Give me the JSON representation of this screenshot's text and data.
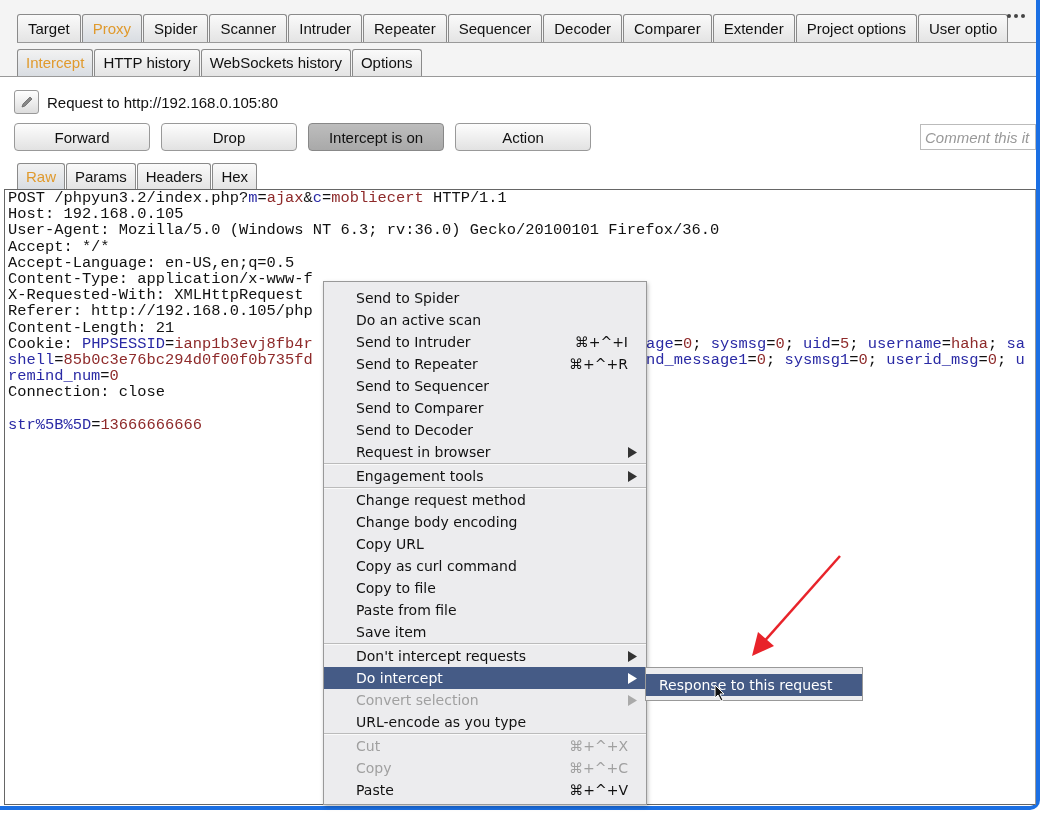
{
  "main_tabs": [
    {
      "label": "Target",
      "selected": false
    },
    {
      "label": "Proxy",
      "selected": true
    },
    {
      "label": "Spider",
      "selected": false
    },
    {
      "label": "Scanner",
      "selected": false
    },
    {
      "label": "Intruder",
      "selected": false
    },
    {
      "label": "Repeater",
      "selected": false
    },
    {
      "label": "Sequencer",
      "selected": false
    },
    {
      "label": "Decoder",
      "selected": false
    },
    {
      "label": "Comparer",
      "selected": false
    },
    {
      "label": "Extender",
      "selected": false
    },
    {
      "label": "Project options",
      "selected": false
    },
    {
      "label": "User optio",
      "selected": false
    }
  ],
  "proxy_tabs": [
    {
      "label": "Intercept",
      "selected": true
    },
    {
      "label": "HTTP history",
      "selected": false
    },
    {
      "label": "WebSockets history",
      "selected": false
    },
    {
      "label": "Options",
      "selected": false
    }
  ],
  "request_target": "Request to http://192.168.0.105:80",
  "actions": [
    {
      "label": "Forward",
      "pressed": false
    },
    {
      "label": "Drop",
      "pressed": false
    },
    {
      "label": "Intercept is on",
      "pressed": true
    },
    {
      "label": "Action",
      "pressed": false
    }
  ],
  "comment": {
    "placeholder": "Comment this it"
  },
  "editor_tabs": [
    {
      "label": "Raw",
      "selected": true
    },
    {
      "label": "Params",
      "selected": false
    },
    {
      "label": "Headers",
      "selected": false
    },
    {
      "label": "Hex",
      "selected": false
    }
  ],
  "request_lines": [
    {
      "parts": [
        {
          "kind": "plain",
          "text": "POST /phpyun3.2/index.php?"
        },
        {
          "kind": "name",
          "text": "m"
        },
        {
          "kind": "plain",
          "text": "="
        },
        {
          "kind": "value",
          "text": "ajax"
        },
        {
          "kind": "plain",
          "text": "&"
        },
        {
          "kind": "name",
          "text": "c"
        },
        {
          "kind": "plain",
          "text": "="
        },
        {
          "kind": "value",
          "text": "mobliecert"
        },
        {
          "kind": "plain",
          "text": " HTTP/1.1"
        }
      ]
    },
    {
      "parts": [
        {
          "kind": "plain",
          "text": "Host: 192.168.0.105"
        }
      ]
    },
    {
      "parts": [
        {
          "kind": "plain",
          "text": "User-Agent: Mozilla/5.0 (Windows NT 6.3; rv:36.0) Gecko/20100101 Firefox/36.0"
        }
      ]
    },
    {
      "parts": [
        {
          "kind": "plain",
          "text": "Accept: */*"
        }
      ]
    },
    {
      "parts": [
        {
          "kind": "plain",
          "text": "Accept-Language: en-US,en;q=0.5"
        }
      ]
    },
    {
      "parts": [
        {
          "kind": "plain",
          "text": "Content-Type: application/x-www-f"
        }
      ]
    },
    {
      "parts": [
        {
          "kind": "plain",
          "text": "X-Requested-With: XMLHttpRequest"
        }
      ]
    },
    {
      "parts": [
        {
          "kind": "plain",
          "text": "Referer: http://192.168.0.105/php"
        }
      ]
    },
    {
      "parts": [
        {
          "kind": "plain",
          "text": "Content-Length: 21"
        }
      ]
    },
    {
      "parts": [
        {
          "kind": "plain",
          "text": "Cookie: "
        },
        {
          "kind": "name",
          "text": "PHPSESSID"
        },
        {
          "kind": "plain",
          "text": "="
        },
        {
          "kind": "value",
          "text": "ianp1b3evj8fb4r"
        }
      ],
      "after_menu": [
        {
          "kind": "name",
          "text": "age"
        },
        {
          "kind": "plain",
          "text": "="
        },
        {
          "kind": "value",
          "text": "0"
        },
        {
          "kind": "plain",
          "text": "; "
        },
        {
          "kind": "name",
          "text": "sysmsg"
        },
        {
          "kind": "plain",
          "text": "="
        },
        {
          "kind": "value",
          "text": "0"
        },
        {
          "kind": "plain",
          "text": "; "
        },
        {
          "kind": "name",
          "text": "uid"
        },
        {
          "kind": "plain",
          "text": "="
        },
        {
          "kind": "value",
          "text": "5"
        },
        {
          "kind": "plain",
          "text": "; "
        },
        {
          "kind": "name",
          "text": "username"
        },
        {
          "kind": "plain",
          "text": "="
        },
        {
          "kind": "value",
          "text": "haha"
        },
        {
          "kind": "plain",
          "text": "; "
        },
        {
          "kind": "name",
          "text": "sa"
        }
      ]
    },
    {
      "parts": [
        {
          "kind": "name",
          "text": "shell"
        },
        {
          "kind": "plain",
          "text": "="
        },
        {
          "kind": "value",
          "text": "85b0c3e76bc294d0f00f0b735fd"
        }
      ],
      "after_menu": [
        {
          "kind": "name",
          "text": "nd_message1"
        },
        {
          "kind": "plain",
          "text": "="
        },
        {
          "kind": "value",
          "text": "0"
        },
        {
          "kind": "plain",
          "text": "; "
        },
        {
          "kind": "name",
          "text": "sysmsg1"
        },
        {
          "kind": "plain",
          "text": "="
        },
        {
          "kind": "value",
          "text": "0"
        },
        {
          "kind": "plain",
          "text": "; "
        },
        {
          "kind": "name",
          "text": "userid_msg"
        },
        {
          "kind": "plain",
          "text": "="
        },
        {
          "kind": "value",
          "text": "0"
        },
        {
          "kind": "plain",
          "text": "; "
        },
        {
          "kind": "name",
          "text": "u"
        }
      ]
    },
    {
      "parts": [
        {
          "kind": "name",
          "text": "remind_num"
        },
        {
          "kind": "plain",
          "text": "="
        },
        {
          "kind": "value",
          "text": "0"
        }
      ]
    },
    {
      "parts": [
        {
          "kind": "plain",
          "text": "Connection: close"
        }
      ]
    },
    {
      "blank_line_before": true,
      "parts": [
        {
          "kind": "name",
          "text": "str%5B%5D"
        },
        {
          "kind": "plain",
          "text": "="
        },
        {
          "kind": "value",
          "text": "13666666666"
        }
      ]
    }
  ],
  "context_menu": {
    "groups": [
      [
        {
          "label": "Send to Spider",
          "kind": "item",
          "disabled": false,
          "selected": false
        },
        {
          "label": "Do an active scan",
          "kind": "item",
          "disabled": false,
          "selected": false
        },
        {
          "label": "Send to Intruder",
          "shortcut": "⌘+^+I",
          "kind": "item",
          "disabled": false,
          "selected": false
        },
        {
          "label": "Send to Repeater",
          "shortcut": "⌘+^+R",
          "kind": "item",
          "disabled": false,
          "selected": false
        },
        {
          "label": "Send to Sequencer",
          "kind": "item",
          "disabled": false,
          "selected": false
        },
        {
          "label": "Send to Comparer",
          "kind": "item",
          "disabled": false,
          "selected": false
        },
        {
          "label": "Send to Decoder",
          "kind": "item",
          "disabled": false,
          "selected": false
        },
        {
          "label": "Request in browser",
          "kind": "submenu",
          "disabled": false,
          "selected": false
        }
      ],
      [
        {
          "label": "Engagement tools",
          "kind": "submenu",
          "disabled": false,
          "selected": false
        }
      ],
      [
        {
          "label": "Change request method",
          "kind": "item",
          "disabled": false,
          "selected": false
        },
        {
          "label": "Change body encoding",
          "kind": "item",
          "disabled": false,
          "selected": false
        },
        {
          "label": "Copy URL",
          "kind": "item",
          "disabled": false,
          "selected": false
        },
        {
          "label": "Copy as curl command",
          "kind": "item",
          "disabled": false,
          "selected": false
        },
        {
          "label": "Copy to file",
          "kind": "item",
          "disabled": false,
          "selected": false
        },
        {
          "label": "Paste from file",
          "kind": "item",
          "disabled": false,
          "selected": false
        },
        {
          "label": "Save item",
          "kind": "item",
          "disabled": false,
          "selected": false
        }
      ],
      [
        {
          "label": "Don't intercept requests",
          "kind": "submenu",
          "disabled": false,
          "selected": false
        },
        {
          "label": "Do intercept",
          "kind": "submenu",
          "disabled": false,
          "selected": true,
          "submenu": [
            {
              "label": "Response to this request",
              "selected": true
            }
          ]
        },
        {
          "label": "Convert selection",
          "kind": "submenu",
          "disabled": true,
          "selected": false
        },
        {
          "label": "URL-encode as you type",
          "kind": "item",
          "disabled": false,
          "selected": false
        }
      ],
      [
        {
          "label": "Cut",
          "shortcut": "⌘+^+X",
          "kind": "item",
          "disabled": true,
          "selected": false
        },
        {
          "label": "Copy",
          "shortcut": "⌘+^+C",
          "kind": "item",
          "disabled": true,
          "selected": false
        },
        {
          "label": "Paste",
          "shortcut": "⌘+^+V",
          "kind": "item",
          "disabled": false,
          "selected": false
        }
      ]
    ]
  }
}
